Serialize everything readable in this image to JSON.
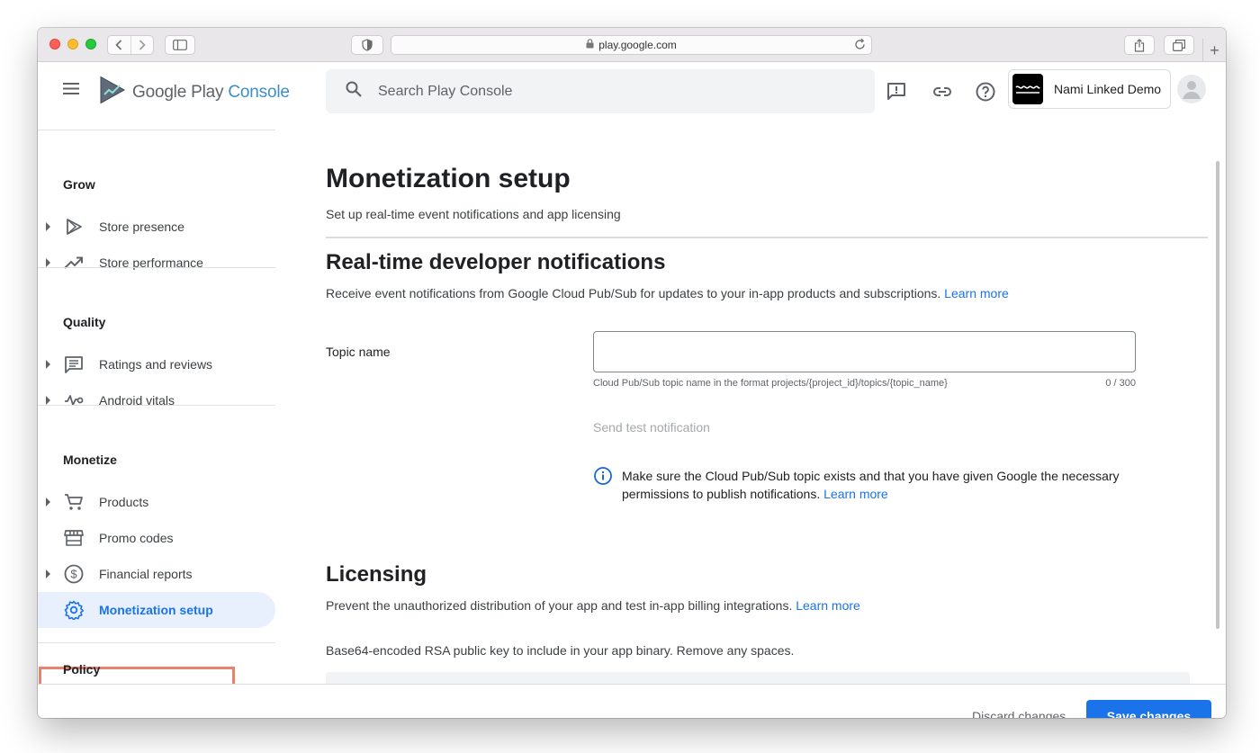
{
  "browser": {
    "url": "play.google.com"
  },
  "header": {
    "logo_google": "Google Play",
    "logo_console": "Console",
    "search_placeholder": "Search Play Console",
    "account_name": "Nami Linked Demo"
  },
  "sidebar": {
    "sections": [
      {
        "title": "Grow"
      },
      {
        "title": "Quality"
      },
      {
        "title": "Monetize"
      },
      {
        "title": "Policy"
      }
    ],
    "items": [
      {
        "label": "Store presence",
        "icon": "play-triangle-icon"
      },
      {
        "label": "Store performance",
        "icon": "trending-up-icon"
      },
      {
        "label": "Ratings and reviews",
        "icon": "reviews-icon"
      },
      {
        "label": "Android vitals",
        "icon": "vitals-icon"
      },
      {
        "label": "Products",
        "icon": "cart-icon"
      },
      {
        "label": "Promo codes",
        "icon": "store-icon"
      },
      {
        "label": "Financial reports",
        "icon": "dollar-icon"
      },
      {
        "label": "Monetization setup",
        "icon": "gear-icon",
        "active": true
      }
    ]
  },
  "main": {
    "title": "Monetization setup",
    "subtitle": "Set up real-time event notifications and app licensing",
    "rtdn": {
      "heading": "Real-time developer notifications",
      "description": "Receive event notifications from Google Cloud Pub/Sub for updates to your in-app products and subscriptions.",
      "learn_more": "Learn more",
      "topic_label": "Topic name",
      "topic_value": "",
      "topic_hint": "Cloud Pub/Sub topic name in the format projects/{project_id}/topics/{topic_name}",
      "topic_counter": "0 / 300",
      "send_test": "Send test notification",
      "info_text": "Make sure the Cloud Pub/Sub topic exists and that you have given Google the necessary permissions to publish notifications.",
      "info_learn_more": "Learn more"
    },
    "licensing": {
      "heading": "Licensing",
      "description": "Prevent the unauthorized distribution of your app and test in-app billing integrations.",
      "learn_more": "Learn more",
      "key_label": "Base64-encoded RSA public key to include in your app binary. Remove any spaces."
    }
  },
  "footer": {
    "discard_label": "Discard changes",
    "save_label": "Save changes"
  },
  "colors": {
    "accent": "#1a73e8",
    "highlight_box": "#e8826f"
  }
}
